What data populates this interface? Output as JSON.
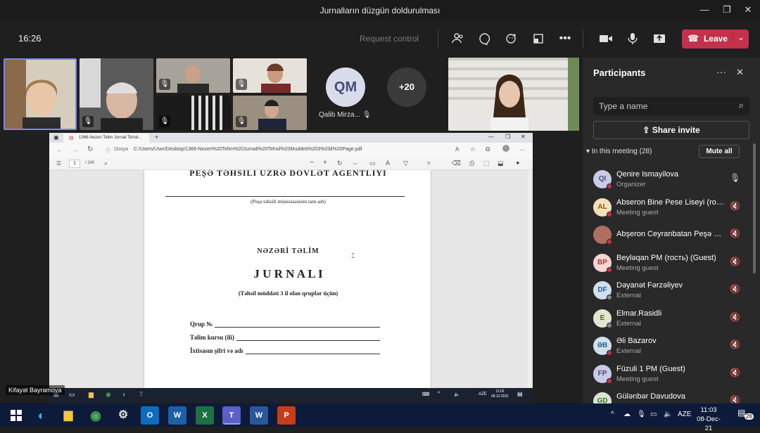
{
  "window": {
    "title": "Jurnalların düzgün doldurulması"
  },
  "toolbar": {
    "time": "16:26",
    "request_control": "Request control",
    "leave_label": "Leave"
  },
  "tiles": {
    "qm_initials": "QM",
    "qm_name": "Qalib Mirza...",
    "overflow": "+20",
    "presenter_name": "Kifayət Bayramova"
  },
  "shared": {
    "tab_title": "1366-Nezeri Telim Jurnali Tehsil...",
    "address": "C:/Users/User/Desktop/1366-Nezeri%20Telim%20Jurnali%20Tehsil%20Muddeti%203%20il%20Page.pdf",
    "address_prefix": "Dosya",
    "page_num": "1",
    "page_total": "/ 240",
    "agency": "PEŞƏ TƏHSİLİ ÜZRƏ DÖVLƏT AGENTLİYİ",
    "inst_caption": "(Peşə təhsili müəssisəsinin tam adı)",
    "subtitle": "NƏZƏRİ TƏLİM",
    "main_title": "J U R N A L I",
    "duration": "(Təhsil müddəti 3 il olan qruplar üçün)",
    "field_group": "Qrup №",
    "field_course": "Təlim kursu (ili)",
    "field_spec": "İxtisasın şifri və adı",
    "taskbar_time": "11:02",
    "taskbar_date": "08.12.2021",
    "taskbar_lang": "AZE"
  },
  "panel": {
    "title": "Participants",
    "search_placeholder": "Type a name",
    "share_invite": "Share invite",
    "in_meeting": "In this meeting (28)",
    "mute_all": "Mute all",
    "participants": [
      {
        "initials": "QI",
        "name": "Qenire Ismayilova",
        "role": "Organizer",
        "bg": "#c9cbe8",
        "fg": "#444c7a",
        "status": "#c4314b",
        "mic": "on"
      },
      {
        "initials": "AL",
        "name": "Abseron Bine Pese Liseyi (rос...",
        "role": "Meeting guest",
        "bg": "#f3dfb8",
        "fg": "#8a5a10",
        "status": "#c4314b",
        "mic": "off"
      },
      {
        "initials": "",
        "name": "Abşeron Ceyranbatan Peşə Lis...",
        "role": "",
        "bg": "#b07060",
        "fg": "#fff",
        "status": "#c4314b",
        "mic": "off"
      },
      {
        "initials": "BP",
        "name": "Beyləqan PM (гость) (Guest)",
        "role": "Meeting guest",
        "bg": "#f6d4d2",
        "fg": "#a33a35",
        "status": "#c4314b",
        "mic": "off"
      },
      {
        "initials": "DF",
        "name": "Dəyanət Fərzəliyev",
        "role": "External",
        "bg": "#cfe0ef",
        "fg": "#2c5d8a",
        "status": "#888888",
        "mic": "off"
      },
      {
        "initials": "E",
        "name": "Elmar.Rasidli",
        "role": "External",
        "bg": "#e0e6d0",
        "fg": "#4f6128",
        "status": "#888888",
        "mic": "off"
      },
      {
        "initials": "ƏB",
        "name": "Əli Bazarov",
        "role": "External",
        "bg": "#cfe0ef",
        "fg": "#2c5d8a",
        "status": "#c4314b",
        "mic": "off"
      },
      {
        "initials": "FP",
        "name": "Füzuli 1 PM (Guest)",
        "role": "Meeting guest",
        "bg": "#c9cbe8",
        "fg": "#444c7a",
        "status": "#c4314b",
        "mic": "off"
      },
      {
        "initials": "GD",
        "name": "Gülənbər Davudova",
        "role": "External",
        "bg": "#d8e8d0",
        "fg": "#3f6a2e",
        "status": "#888888",
        "mic": "off"
      }
    ]
  },
  "taskbar": {
    "lang": "AZE",
    "time": "11:03",
    "date": "08-Dec-21",
    "notifications": "26"
  }
}
